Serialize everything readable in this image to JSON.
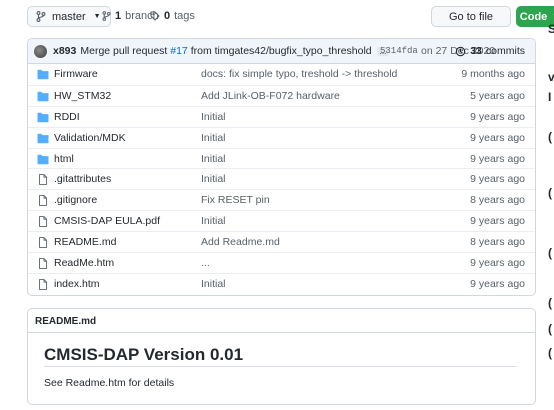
{
  "toolbar": {
    "branch_label": "master",
    "branches_count": "1",
    "branches_label": "branch",
    "tags_count": "0",
    "tags_label": "tags",
    "goto_label": "Go to file",
    "code_label": "Code"
  },
  "commit": {
    "author": "x893",
    "message_prefix": "Merge pull request",
    "pr_link": "#17",
    "message_suffix": "from timgates42/bugfix_typo_threshold",
    "ellipsis": "...",
    "hash": "5314fda",
    "date": "on 27 Dec 2020",
    "count": "33",
    "count_label": "commits"
  },
  "files": [
    {
      "type": "folder",
      "name": "Firmware",
      "message": "docs: fix simple typo, treshold -> threshold",
      "age": "9 months ago"
    },
    {
      "type": "folder",
      "name": "HW_STM32",
      "message": "Add JLink-OB-F072 hardware",
      "age": "5 years ago"
    },
    {
      "type": "folder",
      "name": "RDDI",
      "message": "Initial",
      "age": "9 years ago"
    },
    {
      "type": "folder",
      "name": "Validation/MDK",
      "message": "Initial",
      "age": "9 years ago"
    },
    {
      "type": "folder",
      "name": "html",
      "message": "Initial",
      "age": "9 years ago"
    },
    {
      "type": "file",
      "name": ".gitattributes",
      "message": "Initial",
      "age": "9 years ago"
    },
    {
      "type": "file",
      "name": ".gitignore",
      "message": "Fix RESET pin",
      "age": "8 years ago"
    },
    {
      "type": "file",
      "name": "CMSIS-DAP EULA.pdf",
      "message": "Initial",
      "age": "9 years ago"
    },
    {
      "type": "file",
      "name": "README.md",
      "message": "Add Readme.md",
      "age": "8 years ago"
    },
    {
      "type": "file",
      "name": "ReadMe.htm",
      "message": "...",
      "age": "9 years ago"
    },
    {
      "type": "file",
      "name": "index.htm",
      "message": "Initial",
      "age": "9 years ago"
    }
  ],
  "readme": {
    "filename": "README.md",
    "title": "CMSIS-DAP Version 0.01",
    "text": "See Readme.htm for details"
  },
  "edge_fragments": [
    "S",
    "v",
    "I",
    "(",
    "(",
    "(",
    "(",
    "(",
    "("
  ],
  "colors": {
    "folder": "#54aeff",
    "link": "#0969da",
    "primary_button": "#2da44e",
    "commit_bar": "#f0f5fb"
  }
}
